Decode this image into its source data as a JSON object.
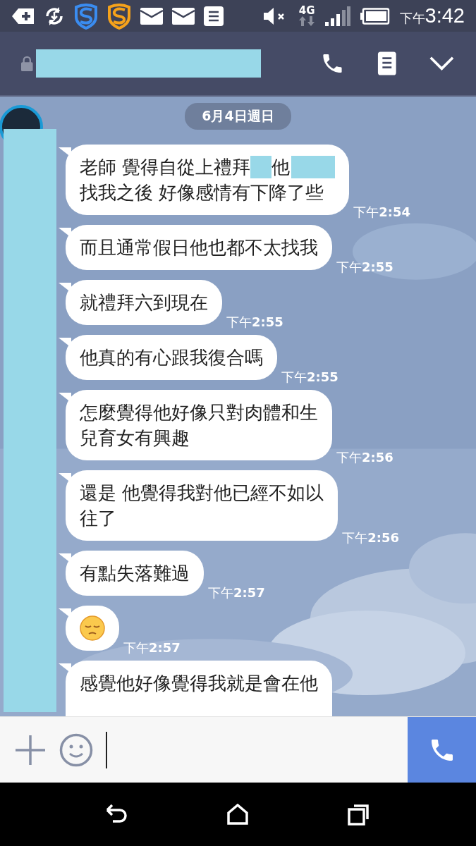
{
  "status_bar": {
    "network": "4G",
    "time_prefix": "下午",
    "time": "3:42"
  },
  "date_label": "6月4日週日",
  "messages": [
    {
      "kind": "text",
      "time": "下午**2:54**",
      "lines": [
        [
          {
            "kind": "text",
            "text": "老師 覺得自從上禮拜"
          },
          {
            "kind": "redaction_small"
          },
          {
            "kind": "text",
            "text": "他"
          },
          {
            "kind": "redaction_large"
          }
        ],
        [
          {
            "kind": "text",
            "text": "找我之後 好像感情有下降了些"
          }
        ]
      ]
    },
    {
      "kind": "text",
      "time": "下午**2:55**",
      "lines": [
        [
          {
            "kind": "text",
            "text": "而且通常假日他也都不太找我"
          }
        ]
      ]
    },
    {
      "kind": "text",
      "time": "下午**2:55**",
      "lines": [
        [
          {
            "kind": "text",
            "text": "就禮拜六到現在"
          }
        ]
      ]
    },
    {
      "kind": "text",
      "time": "下午**2:55**",
      "lines": [
        [
          {
            "kind": "text",
            "text": "他真的有心跟我復合嗎"
          }
        ]
      ]
    },
    {
      "kind": "text",
      "time": "下午**2:56**",
      "lines": [
        [
          {
            "kind": "text",
            "text": "怎麼覺得他好像只對肉體和生"
          }
        ],
        [
          {
            "kind": "text",
            "text": "兒育女有興趣"
          }
        ]
      ]
    },
    {
      "kind": "text",
      "time": "下午**2:56**",
      "lines": [
        [
          {
            "kind": "text",
            "text": "還是 他覺得我對他已經不如以"
          }
        ],
        [
          {
            "kind": "text",
            "text": "往了"
          }
        ]
      ]
    },
    {
      "kind": "text",
      "time": "下午**2:57**",
      "lines": [
        [
          {
            "kind": "text",
            "text": "有點失落難過"
          }
        ]
      ]
    },
    {
      "kind": "emoji",
      "time": "下午**2:57**"
    },
    {
      "kind": "text",
      "lines": [
        [
          {
            "kind": "text",
            "text": "感覺他好像覺得我就是會在他"
          }
        ]
      ]
    }
  ]
}
